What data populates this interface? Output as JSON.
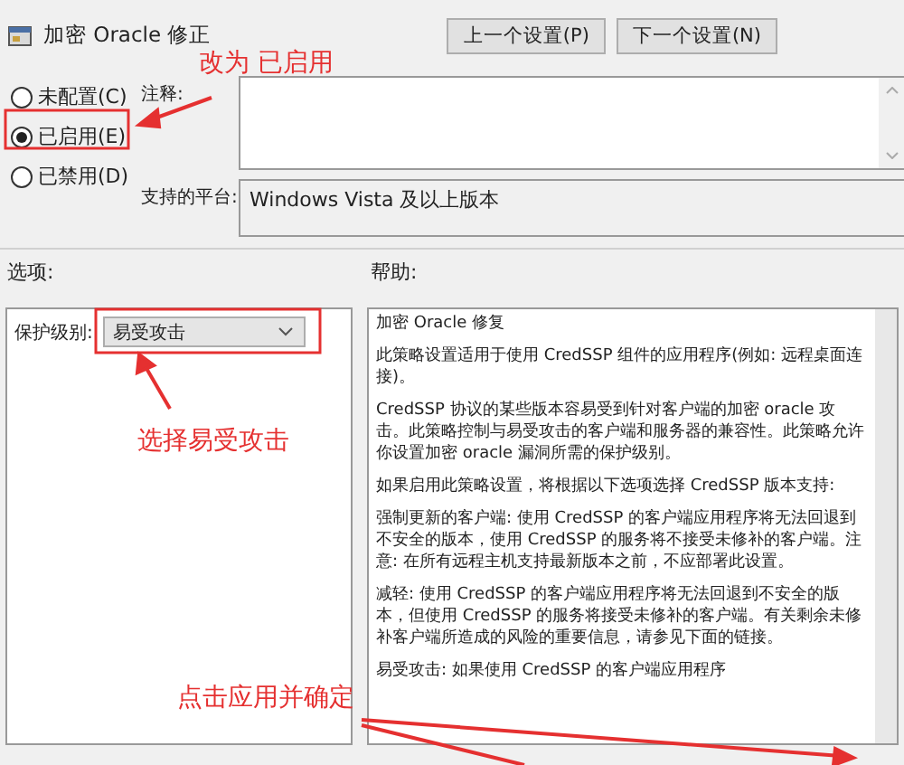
{
  "window": {
    "title": "加密 Oracle 修正"
  },
  "nav_buttons": [
    "上一个设置(P)",
    "下一个设置(N)"
  ],
  "radios": [
    {
      "label": "未配置(C)",
      "selected": false
    },
    {
      "label": "已启用(E)",
      "selected": true
    },
    {
      "label": "已禁用(D)",
      "selected": false
    }
  ],
  "comment": {
    "label": "注释:"
  },
  "platform": {
    "label": "支持的平台:",
    "value": "Windows Vista 及以上版本"
  },
  "options": {
    "label": "选项:",
    "protection_label": "保护级别:",
    "protection_value": "易受攻击"
  },
  "help": {
    "label": "帮助:",
    "paragraphs": [
      "加密 Oracle 修复",
      "此策略设置适用于使用 CredSSP 组件的应用程序(例如: 远程桌面连接)。",
      "CredSSP 协议的某些版本容易受到针对客户端的加密 oracle 攻击。此策略控制与易受攻击的客户端和服务器的兼容性。此策略允许你设置加密 oracle 漏洞所需的保护级别。",
      "如果启用此策略设置，将根据以下选项选择 CredSSP 版本支持:",
      "强制更新的客户端: 使用 CredSSP 的客户端应用程序将无法回退到不安全的版本，使用 CredSSP 的服务将不接受未修补的客户端。注意: 在所有远程主机支持最新版本之前，不应部署此设置。",
      "减轻: 使用 CredSSP 的客户端应用程序将无法回退到不安全的版本，但使用 CredSSP 的服务将接受未修补的客户端。有关剩余未修补客户端所造成的风险的重要信息，请参见下面的链接。",
      "易受攻击: 如果使用 CredSSP 的客户端应用程序"
    ]
  },
  "annotations": [
    "改为 已启用",
    "选择易受攻击",
    "点击应用并确定"
  ]
}
